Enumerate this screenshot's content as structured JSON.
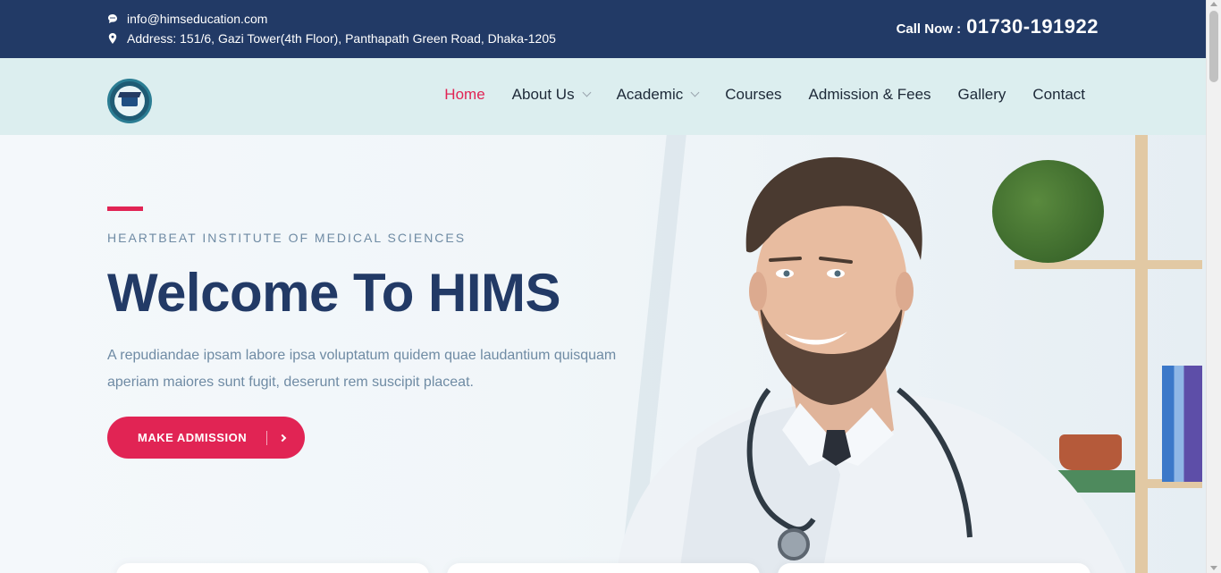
{
  "topbar": {
    "email": "info@himseducation.com",
    "address": "Address: 151/6, Gazi Tower(4th Floor), Panthapath Green Road, Dhaka-1205",
    "call_label": "Call Now :",
    "call_number": "01730-191922",
    "icons": {
      "email": "chat-bubble-icon",
      "address": "map-pin-icon"
    }
  },
  "nav": {
    "logo_alt": "HIMS",
    "items": [
      {
        "label": "Home",
        "active": true
      },
      {
        "label": "About Us",
        "dropdown": true
      },
      {
        "label": "Academic",
        "dropdown": true
      },
      {
        "label": "Courses"
      },
      {
        "label": "Admission & Fees"
      },
      {
        "label": "Gallery"
      },
      {
        "label": "Contact"
      }
    ]
  },
  "hero": {
    "subtitle": "HEARTBEAT INSTITUTE OF MEDICAL SCIENCES",
    "title": "Welcome To HIMS",
    "description": "A repudiandae ipsam labore ipsa voluptatum quidem quae laudantium quisquam aperiam maiores sunt fugit, deserunt rem suscipit placeat.",
    "button_label": "MAKE ADMISSION"
  },
  "colors": {
    "primary": "#223a66",
    "accent": "#e12454",
    "nav_bg": "#dceeef",
    "text_muted": "#6f8ba4"
  }
}
